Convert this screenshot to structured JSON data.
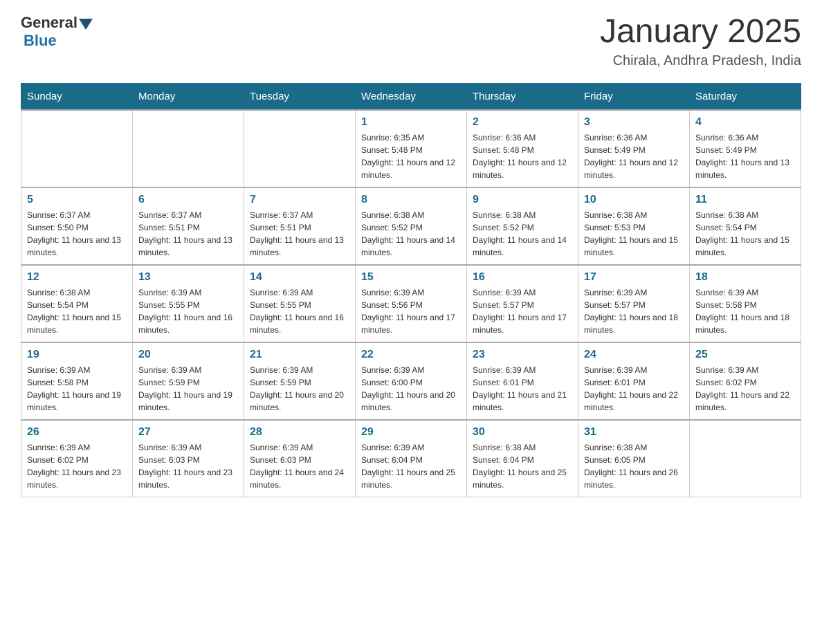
{
  "header": {
    "logo_text_general": "General",
    "logo_text_blue": "Blue",
    "month_year": "January 2025",
    "location": "Chirala, Andhra Pradesh, India"
  },
  "days_of_week": [
    "Sunday",
    "Monday",
    "Tuesday",
    "Wednesday",
    "Thursday",
    "Friday",
    "Saturday"
  ],
  "weeks": [
    [
      {
        "day": "",
        "info": ""
      },
      {
        "day": "",
        "info": ""
      },
      {
        "day": "",
        "info": ""
      },
      {
        "day": "1",
        "info": "Sunrise: 6:35 AM\nSunset: 5:48 PM\nDaylight: 11 hours and 12 minutes."
      },
      {
        "day": "2",
        "info": "Sunrise: 6:36 AM\nSunset: 5:48 PM\nDaylight: 11 hours and 12 minutes."
      },
      {
        "day": "3",
        "info": "Sunrise: 6:36 AM\nSunset: 5:49 PM\nDaylight: 11 hours and 12 minutes."
      },
      {
        "day": "4",
        "info": "Sunrise: 6:36 AM\nSunset: 5:49 PM\nDaylight: 11 hours and 13 minutes."
      }
    ],
    [
      {
        "day": "5",
        "info": "Sunrise: 6:37 AM\nSunset: 5:50 PM\nDaylight: 11 hours and 13 minutes."
      },
      {
        "day": "6",
        "info": "Sunrise: 6:37 AM\nSunset: 5:51 PM\nDaylight: 11 hours and 13 minutes."
      },
      {
        "day": "7",
        "info": "Sunrise: 6:37 AM\nSunset: 5:51 PM\nDaylight: 11 hours and 13 minutes."
      },
      {
        "day": "8",
        "info": "Sunrise: 6:38 AM\nSunset: 5:52 PM\nDaylight: 11 hours and 14 minutes."
      },
      {
        "day": "9",
        "info": "Sunrise: 6:38 AM\nSunset: 5:52 PM\nDaylight: 11 hours and 14 minutes."
      },
      {
        "day": "10",
        "info": "Sunrise: 6:38 AM\nSunset: 5:53 PM\nDaylight: 11 hours and 15 minutes."
      },
      {
        "day": "11",
        "info": "Sunrise: 6:38 AM\nSunset: 5:54 PM\nDaylight: 11 hours and 15 minutes."
      }
    ],
    [
      {
        "day": "12",
        "info": "Sunrise: 6:38 AM\nSunset: 5:54 PM\nDaylight: 11 hours and 15 minutes."
      },
      {
        "day": "13",
        "info": "Sunrise: 6:39 AM\nSunset: 5:55 PM\nDaylight: 11 hours and 16 minutes."
      },
      {
        "day": "14",
        "info": "Sunrise: 6:39 AM\nSunset: 5:55 PM\nDaylight: 11 hours and 16 minutes."
      },
      {
        "day": "15",
        "info": "Sunrise: 6:39 AM\nSunset: 5:56 PM\nDaylight: 11 hours and 17 minutes."
      },
      {
        "day": "16",
        "info": "Sunrise: 6:39 AM\nSunset: 5:57 PM\nDaylight: 11 hours and 17 minutes."
      },
      {
        "day": "17",
        "info": "Sunrise: 6:39 AM\nSunset: 5:57 PM\nDaylight: 11 hours and 18 minutes."
      },
      {
        "day": "18",
        "info": "Sunrise: 6:39 AM\nSunset: 5:58 PM\nDaylight: 11 hours and 18 minutes."
      }
    ],
    [
      {
        "day": "19",
        "info": "Sunrise: 6:39 AM\nSunset: 5:58 PM\nDaylight: 11 hours and 19 minutes."
      },
      {
        "day": "20",
        "info": "Sunrise: 6:39 AM\nSunset: 5:59 PM\nDaylight: 11 hours and 19 minutes."
      },
      {
        "day": "21",
        "info": "Sunrise: 6:39 AM\nSunset: 5:59 PM\nDaylight: 11 hours and 20 minutes."
      },
      {
        "day": "22",
        "info": "Sunrise: 6:39 AM\nSunset: 6:00 PM\nDaylight: 11 hours and 20 minutes."
      },
      {
        "day": "23",
        "info": "Sunrise: 6:39 AM\nSunset: 6:01 PM\nDaylight: 11 hours and 21 minutes."
      },
      {
        "day": "24",
        "info": "Sunrise: 6:39 AM\nSunset: 6:01 PM\nDaylight: 11 hours and 22 minutes."
      },
      {
        "day": "25",
        "info": "Sunrise: 6:39 AM\nSunset: 6:02 PM\nDaylight: 11 hours and 22 minutes."
      }
    ],
    [
      {
        "day": "26",
        "info": "Sunrise: 6:39 AM\nSunset: 6:02 PM\nDaylight: 11 hours and 23 minutes."
      },
      {
        "day": "27",
        "info": "Sunrise: 6:39 AM\nSunset: 6:03 PM\nDaylight: 11 hours and 23 minutes."
      },
      {
        "day": "28",
        "info": "Sunrise: 6:39 AM\nSunset: 6:03 PM\nDaylight: 11 hours and 24 minutes."
      },
      {
        "day": "29",
        "info": "Sunrise: 6:39 AM\nSunset: 6:04 PM\nDaylight: 11 hours and 25 minutes."
      },
      {
        "day": "30",
        "info": "Sunrise: 6:38 AM\nSunset: 6:04 PM\nDaylight: 11 hours and 25 minutes."
      },
      {
        "day": "31",
        "info": "Sunrise: 6:38 AM\nSunset: 6:05 PM\nDaylight: 11 hours and 26 minutes."
      },
      {
        "day": "",
        "info": ""
      }
    ]
  ]
}
